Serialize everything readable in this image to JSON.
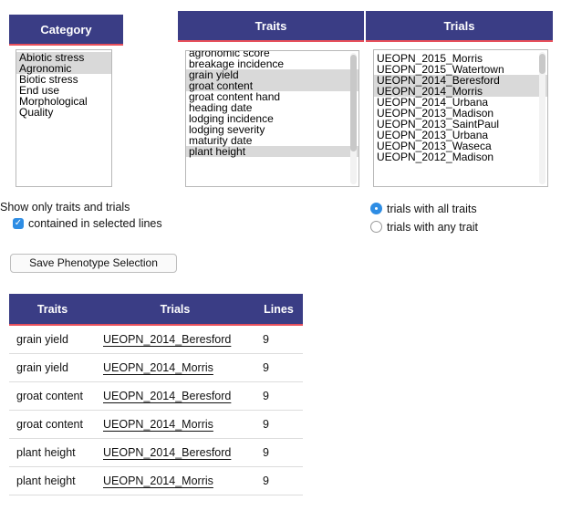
{
  "category": {
    "header": "Category",
    "options": [
      {
        "label": "Abiotic stress",
        "selected": true
      },
      {
        "label": "Agronomic",
        "selected": true
      },
      {
        "label": "Biotic stress",
        "selected": false
      },
      {
        "label": "End use",
        "selected": false
      },
      {
        "label": "Morphological",
        "selected": false
      },
      {
        "label": "Quality",
        "selected": false
      }
    ]
  },
  "traits": {
    "header": "Traits",
    "options": [
      {
        "label": "agronomic score",
        "selected": false
      },
      {
        "label": "breakage incidence",
        "selected": false
      },
      {
        "label": "grain yield",
        "selected": true
      },
      {
        "label": "groat content",
        "selected": true
      },
      {
        "label": "groat content hand",
        "selected": false
      },
      {
        "label": "heading date",
        "selected": false
      },
      {
        "label": "lodging incidence",
        "selected": false
      },
      {
        "label": "lodging severity",
        "selected": false
      },
      {
        "label": "maturity date",
        "selected": false
      },
      {
        "label": "plant height",
        "selected": true
      }
    ]
  },
  "trials": {
    "header": "Trials",
    "options": [
      {
        "label": "UEOPN_2015_Morris",
        "selected": false
      },
      {
        "label": "UEOPN_2015_Watertown",
        "selected": false
      },
      {
        "label": "UEOPN_2014_Beresford",
        "selected": true
      },
      {
        "label": "UEOPN_2014_Morris",
        "selected": true
      },
      {
        "label": "UEOPN_2014_Urbana",
        "selected": false
      },
      {
        "label": "UEOPN_2013_Madison",
        "selected": false
      },
      {
        "label": "UEOPN_2013_SaintPaul",
        "selected": false
      },
      {
        "label": "UEOPN_2013_Urbana",
        "selected": false
      },
      {
        "label": "UEOPN_2013_Waseca",
        "selected": false
      },
      {
        "label": "UEOPN_2012_Madison",
        "selected": false
      }
    ]
  },
  "filter": {
    "show_only_label": "Show only traits and trials",
    "contained_label": "contained in selected lines",
    "contained_checked": true
  },
  "match_mode": {
    "all_label": "trials with all traits",
    "any_label": "trials with any trait",
    "selected": "all"
  },
  "save_button": "Save Phenotype Selection",
  "results": {
    "headers": [
      "Traits",
      "Trials",
      "Lines"
    ],
    "rows": [
      {
        "trait": "grain yield",
        "trial": "UEOPN_2014_Beresford",
        "lines": "9"
      },
      {
        "trait": "grain yield",
        "trial": "UEOPN_2014_Morris",
        "lines": "9"
      },
      {
        "trait": "groat content",
        "trial": "UEOPN_2014_Beresford",
        "lines": "9"
      },
      {
        "trait": "groat content",
        "trial": "UEOPN_2014_Morris",
        "lines": "9"
      },
      {
        "trait": "plant height",
        "trial": "UEOPN_2014_Beresford",
        "lines": "9"
      },
      {
        "trait": "plant height",
        "trial": "UEOPN_2014_Morris",
        "lines": "9"
      }
    ]
  },
  "colors": {
    "header_bg": "#3a3d85",
    "header_accent": "#e8505b",
    "control_blue": "#2e8de4",
    "selected_row": "#d9d9d9"
  }
}
